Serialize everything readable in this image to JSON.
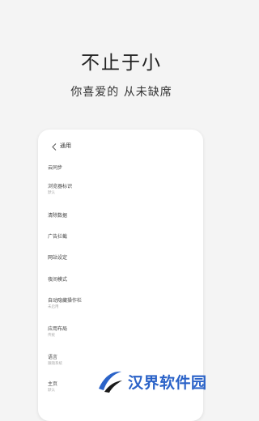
{
  "hero": {
    "title": "不止于小",
    "subtitle": "你喜爱的 从未缺席"
  },
  "settings_screen": {
    "header_title": "通用",
    "back_icon": "chevron-left-icon",
    "items": [
      {
        "label": "云同步",
        "sub": ""
      },
      {
        "label": "浏览器标识",
        "sub": "默认"
      },
      {
        "label": "清除数据",
        "sub": ""
      },
      {
        "label": "广告拦截",
        "sub": ""
      },
      {
        "label": "网站设定",
        "sub": ""
      },
      {
        "label": "夜间模式",
        "sub": ""
      },
      {
        "label": "自动隐藏操作栏",
        "sub": "未启用"
      },
      {
        "label": "应用布局",
        "sub": "传统"
      },
      {
        "label": "语言",
        "sub": "跟随系统"
      },
      {
        "label": "主页",
        "sub": "默认"
      }
    ]
  },
  "watermark": {
    "text": "汉界软件园",
    "icon": "swoosh-logo-icon",
    "color": "#2b63c8"
  }
}
